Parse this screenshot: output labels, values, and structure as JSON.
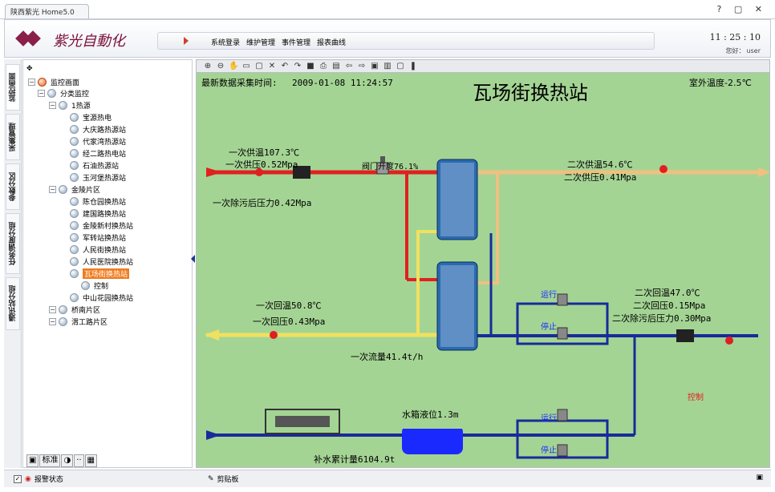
{
  "window": {
    "tab_title": "陕西紫光 Home5.0",
    "controls": "? ▢ ✕"
  },
  "header": {
    "brand": "紫光自動化",
    "menu": [
      "系统登录",
      "维护管理",
      "事件管理",
      "报表曲线"
    ],
    "clock": "11 : 25 : 10",
    "greeting_label": "您好：",
    "user": "user"
  },
  "vtabs": [
    "监控画面",
    "采集管理",
    "参数分区",
    "任务调度分组",
    "通讯站分组"
  ],
  "tree": {
    "root": "监控画面",
    "nodes": [
      {
        "label": "分类监控",
        "level": 1
      },
      {
        "label": "1热源",
        "level": 2
      },
      {
        "label": "宝源热电",
        "level": 3
      },
      {
        "label": "大庆路热源站",
        "level": 3
      },
      {
        "label": "代家湾热源站",
        "level": 3
      },
      {
        "label": "经二路热电站",
        "level": 3
      },
      {
        "label": "石油热源站",
        "level": 3
      },
      {
        "label": "玉河堡热源站",
        "level": 3
      },
      {
        "label": "金陵片区",
        "level": 2
      },
      {
        "label": "陈仓园换热站",
        "level": 3
      },
      {
        "label": "建国路换热站",
        "level": 3
      },
      {
        "label": "金陵新村换热站",
        "level": 3
      },
      {
        "label": "军转站换热站",
        "level": 3
      },
      {
        "label": "人民街换热站",
        "level": 3
      },
      {
        "label": "人民医院换热站",
        "level": 3
      },
      {
        "label": "瓦场街换热站",
        "level": 3,
        "selected": true
      },
      {
        "label": "控制",
        "level": 4
      },
      {
        "label": "中山花园换热站",
        "level": 3
      },
      {
        "label": "桥南片区",
        "level": 2
      },
      {
        "label": "渭工路片区",
        "level": 2
      }
    ],
    "toolbar_label": "标准"
  },
  "scada": {
    "timestamp_label": "最新数据采集时间:",
    "timestamp": "2009-01-08 11:24:57",
    "title": "瓦场街换热站",
    "outdoor_temp": "室外温度-2.5℃",
    "primary_supply_temp": "一次供温107.3℃",
    "primary_supply_pressure": "一次供压0.52Mpa",
    "primary_filter_pressure": "一次除污后压力0.42Mpa",
    "valve_opening": "阀门开度76.1%",
    "secondary_supply_temp": "二次供温54.6℃",
    "secondary_supply_pressure": "二次供压0.41Mpa",
    "primary_return_temp": "一次回温50.8℃",
    "primary_return_pressure": "一次回压0.43Mpa",
    "primary_flow": "一次流量41.4t/h",
    "secondary_return_temp": "二次回温47.0℃",
    "secondary_return_pressure": "二次回压0.15Mpa",
    "secondary_filter_pressure": "二次除污后压力0.30Mpa",
    "pump_run_1": "运行",
    "pump_stop_1": "停止",
    "pump_run_2": "运行",
    "pump_stop_2": "停止",
    "tank_level": "水箱液位1.3m",
    "makeup_meter": "补水累计量6104.9t",
    "control_link": "控制",
    "colors": {
      "background": "#a4d494",
      "supply": "#e02020",
      "return": "#f0e060",
      "secondary_supply": "#f0c080",
      "secondary_return": "#1a2a9a",
      "control": "#e02020"
    }
  },
  "statusbar": {
    "alarm_label": "报警状态",
    "clipboard_label": "剪贴板"
  }
}
